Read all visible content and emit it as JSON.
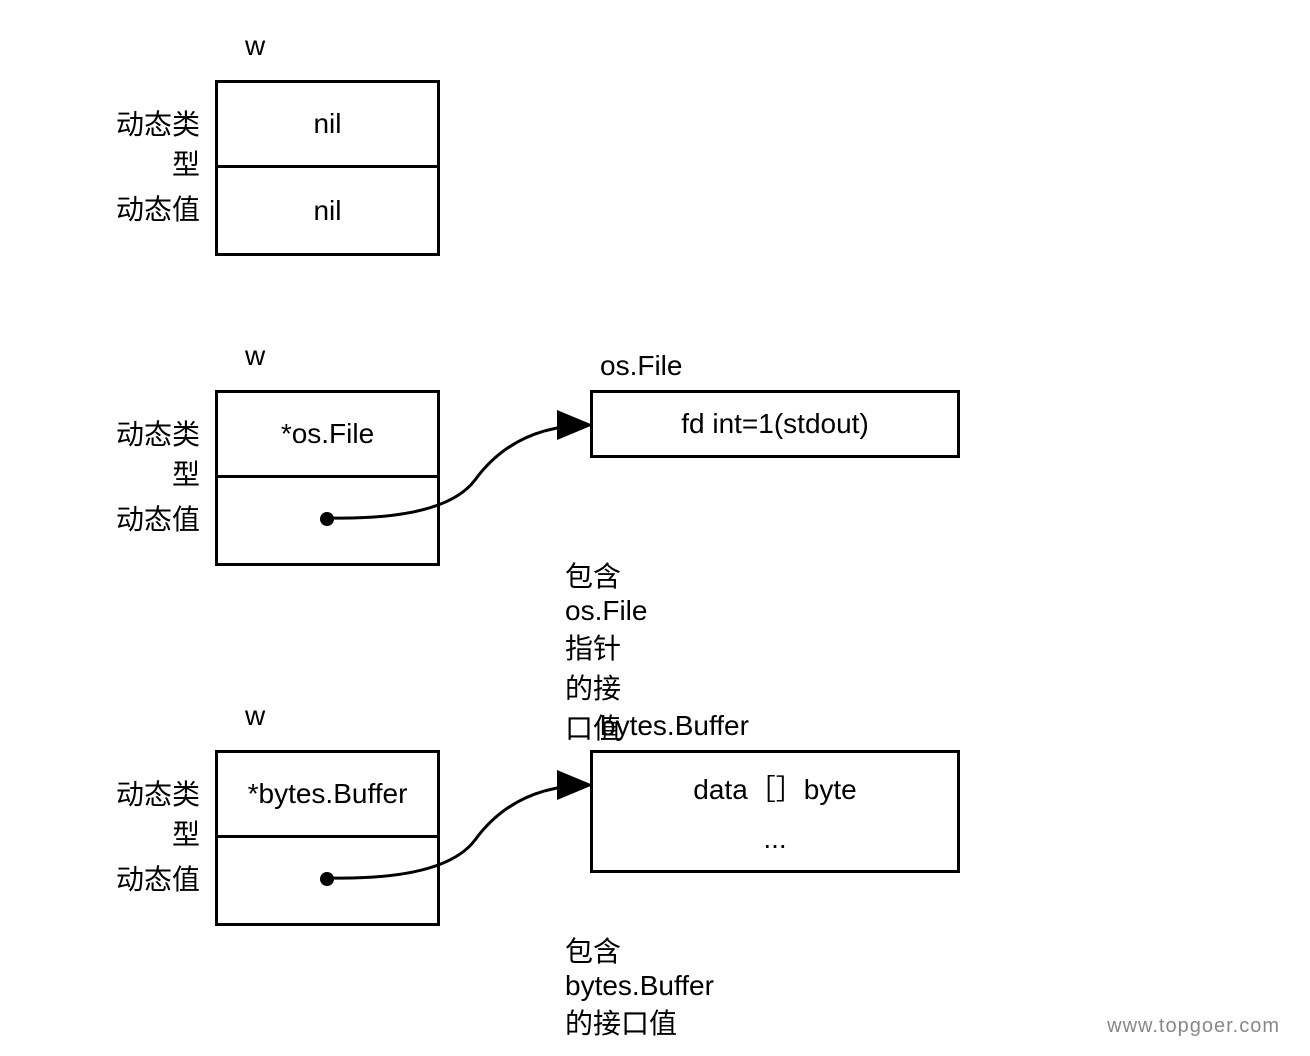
{
  "diagrams": [
    {
      "var": "w",
      "rows": [
        {
          "label": "动态类型",
          "value": "nil"
        },
        {
          "label": "动态值",
          "value": "nil"
        }
      ]
    },
    {
      "var": "w",
      "rows": [
        {
          "label": "动态类型",
          "value": "*os.File"
        },
        {
          "label": "动态值",
          "value": ""
        }
      ],
      "pointerHeader": "os.File",
      "pointerLines": [
        "fd int=1(stdout)"
      ],
      "caption": "包含os.File指针的接口值"
    },
    {
      "var": "w",
      "rows": [
        {
          "label": "动态类型",
          "value": "*bytes.Buffer"
        },
        {
          "label": "动态值",
          "value": ""
        }
      ],
      "pointerHeader": "bytes.Buffer",
      "pointerLines": [
        "data［］byte",
        "..."
      ],
      "caption": "包含bytes.Buffer的接口值"
    }
  ],
  "footer": "www.topgoer.com"
}
